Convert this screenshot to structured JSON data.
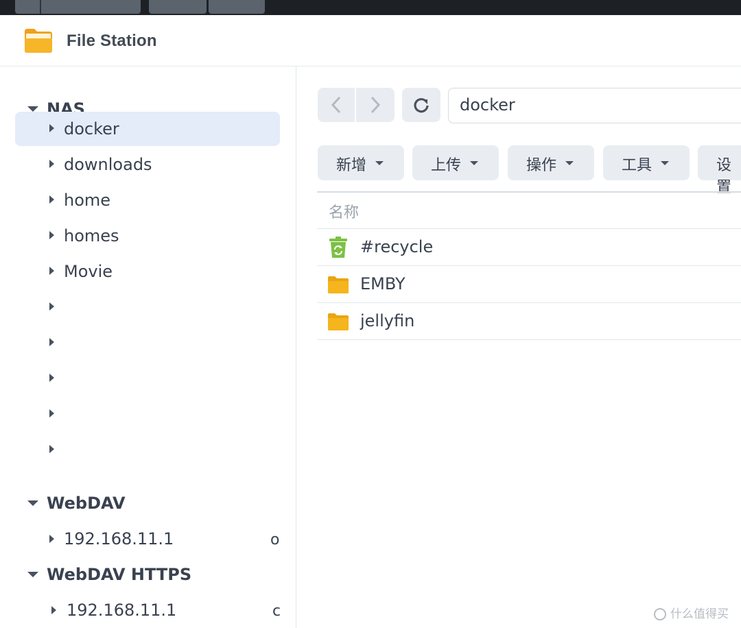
{
  "window": {
    "title": "File Station"
  },
  "sidebar": {
    "groups": [
      {
        "label": "NAS",
        "items": [
          {
            "label": "docker",
            "trail": "",
            "selected": true
          },
          {
            "label": "downloads",
            "trail": ""
          },
          {
            "label": "home",
            "trail": ""
          },
          {
            "label": "homes",
            "trail": ""
          },
          {
            "label": "Movie",
            "trail": ""
          },
          {
            "label": "",
            "trail": ""
          },
          {
            "label": "",
            "trail": ""
          },
          {
            "label": "",
            "trail": ""
          },
          {
            "label": "",
            "trail": ""
          },
          {
            "label": "",
            "trail": ""
          }
        ]
      },
      {
        "label": "WebDAV",
        "items": [
          {
            "label": "192.168.11.1",
            "trail": "o"
          }
        ]
      },
      {
        "label": "WebDAV HTTPS",
        "items": [
          {
            "label": "192.168.11.1",
            "trail": "c"
          }
        ]
      }
    ]
  },
  "path": {
    "value": "docker"
  },
  "toolbar": {
    "new_label": "新增",
    "upload_label": "上传",
    "action_label": "操作",
    "tools_label": "工具",
    "settings_label": "设置"
  },
  "list": {
    "column_name": "名称",
    "files": [
      {
        "name": "#recycle",
        "icon": "recycle-bin-icon"
      },
      {
        "name": "EMBY",
        "icon": "folder-icon"
      },
      {
        "name": "jellyfin",
        "icon": "folder-icon"
      }
    ]
  },
  "colors": {
    "folder": "#f5b51c",
    "recycle": "#7cc144",
    "selection": "#e3ecf8",
    "button_bg": "#e9edf2"
  },
  "watermark": {
    "text": "什么值得买"
  }
}
